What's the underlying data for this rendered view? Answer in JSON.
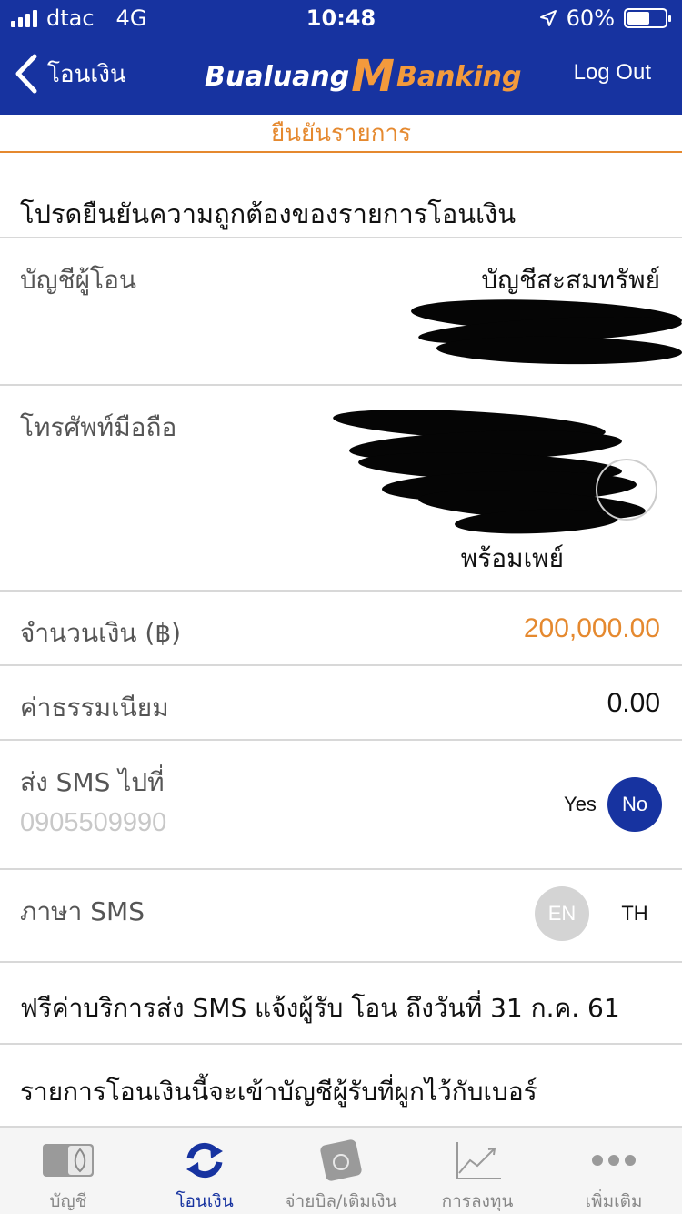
{
  "status_bar": {
    "carrier": "dtac",
    "network": "4G",
    "time": "10:48",
    "battery": "60%"
  },
  "nav": {
    "back_label": "โอนเงิน",
    "logo_left": "Bualuang",
    "logo_mid": "M",
    "logo_right": "Banking",
    "logout_label": "Log Out"
  },
  "page": {
    "subtitle": "ยืนยันรายการ",
    "intro": "โปรดยืนยันความถูกต้องของรายการโอนเงิน"
  },
  "rows": {
    "sender": {
      "label": "บัญชีผู้โอน",
      "value": "บัญชีสะสมทรัพย์"
    },
    "mobile": {
      "label": "โทรศัพท์มือถือ",
      "value": "พร้อมเพย์"
    },
    "amount": {
      "label": "จำนวนเงิน (฿)",
      "value": "200,000.00"
    },
    "fee": {
      "label": "ค่าธรรมเนียม",
      "value": "0.00"
    },
    "sms": {
      "label": "ส่ง SMS ไปที่",
      "phone": "0905509990",
      "yes": "Yes",
      "no": "No"
    },
    "sms_lang": {
      "label": "ภาษา SMS",
      "en": "EN",
      "th": "TH"
    },
    "free_notice": "ฟรีค่าบริการส่ง SMS แจ้งผู้รับ โอน ถึงวันที่ 31 ก.ค. 61",
    "note_line1": "รายการโอนเงินนี้จะเข้าบัญชีผู้รับที่ผูกไว้กับเบอร์"
  },
  "tabbar": [
    {
      "label": "บัญชี",
      "icon": "account-card-icon"
    },
    {
      "label": "โอนเงิน",
      "icon": "transfer-arrows-icon"
    },
    {
      "label": "จ่ายบิล/เติมเงิน",
      "icon": "bill-wallet-icon"
    },
    {
      "label": "การลงทุน",
      "icon": "investment-chart-icon"
    },
    {
      "label": "เพิ่มเติม",
      "icon": "more-dots-icon"
    }
  ],
  "colors": {
    "brand_blue": "#1733a0",
    "accent_orange": "#e5892f",
    "divider": "#d8d8d8"
  }
}
